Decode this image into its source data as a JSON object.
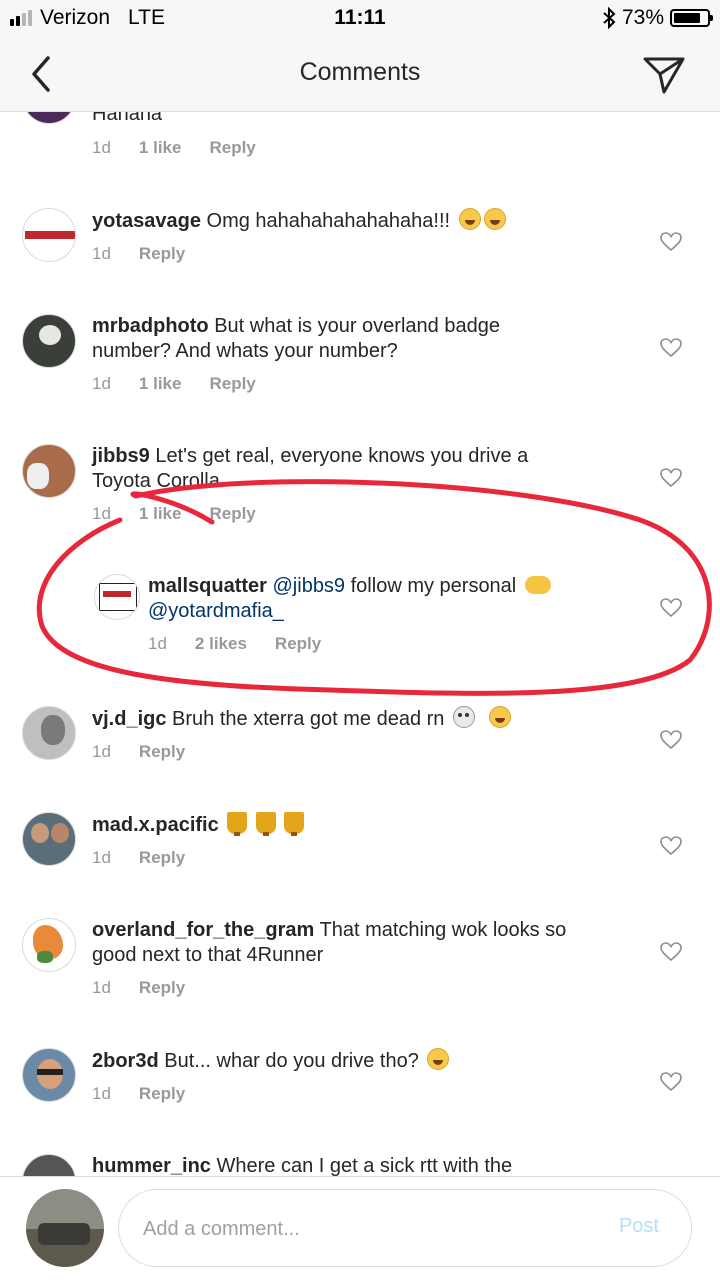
{
  "status_bar": {
    "carrier": "Verizon",
    "network": "LTE",
    "time": "11:11",
    "battery_percent": "73%",
    "signal_bars": 2,
    "signal_total": 4
  },
  "nav": {
    "title": "Comments",
    "back_icon": "chevron-left-icon",
    "share_icon": "paper-plane-icon"
  },
  "comments": [
    {
      "user": "",
      "text": "Hahaha",
      "time": "1d",
      "likes": "1 like",
      "reply": "Reply"
    },
    {
      "user": "yotasavage",
      "text": "Omg hahahahahahahaha!!!",
      "emoji": [
        "laugh",
        "laugh"
      ],
      "time": "1d",
      "likes": "",
      "reply": "Reply"
    },
    {
      "user": "mrbadphoto",
      "text": "But what is your overland badge",
      "text2": "number? And whats your number?",
      "time": "1d",
      "likes": "1 like",
      "reply": "Reply"
    },
    {
      "user": "jibbs9",
      "text": "Let's get real, everyone knows you drive a",
      "text2": "Toyota Corolla",
      "time": "1d",
      "likes": "1 like",
      "reply": "Reply"
    },
    {
      "user": "mallsquatter",
      "mention": "@jibbs9",
      "text": "follow my personal",
      "mention2": "@yotardmafia_",
      "time": "1d",
      "likes": "2 likes",
      "reply": "Reply"
    },
    {
      "user": "vj.d_igc",
      "text": "Bruh the xterra got me dead rn",
      "time": "1d",
      "likes": "",
      "reply": "Reply"
    },
    {
      "user": "mad.x.pacific",
      "text": "",
      "time": "1d",
      "likes": "",
      "reply": "Reply"
    },
    {
      "user": "overland_for_the_gram",
      "text": "That matching wok looks so",
      "text2": "good next to that 4Runner",
      "time": "1d",
      "likes": "",
      "reply": "Reply"
    },
    {
      "user": "2bor3d",
      "text": "But... whar do you drive tho?",
      "time": "1d",
      "likes": "",
      "reply": "Reply"
    },
    {
      "user": "hummer_inc",
      "text": "Where can I get a sick rtt with the",
      "time": "",
      "likes": "",
      "reply": ""
    }
  ],
  "composer": {
    "placeholder": "Add a comment...",
    "post_label": "Post"
  },
  "colors": {
    "annotation": "#e8283a",
    "mention": "#003569",
    "post_disabled": "#b2dffc",
    "meta": "#999999"
  }
}
